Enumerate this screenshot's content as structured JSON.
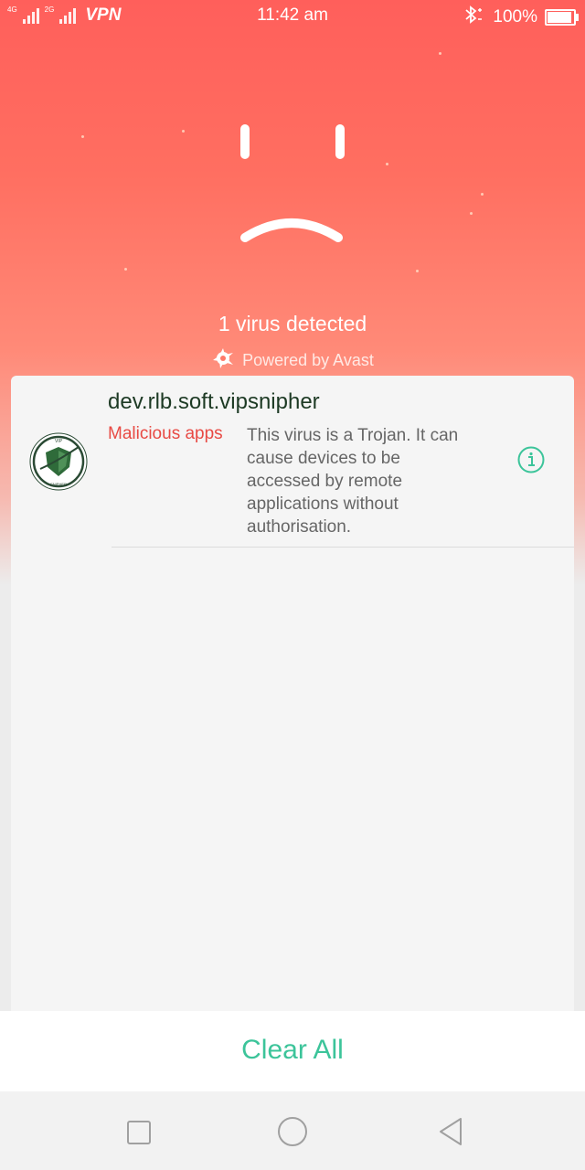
{
  "status_bar": {
    "network_1": "4G",
    "network_2": "2G",
    "vpn": "VPN",
    "time": "11:42 am",
    "battery": "100%",
    "battery_level": 1.0
  },
  "hero": {
    "face_expression": "sad-face-icon",
    "message": "1 virus detected",
    "powered_by": "Powered by Avast"
  },
  "threats": [
    {
      "package": "dev.rlb.soft.vipsnipher",
      "category": "Malicious apps",
      "description": "This virus is a Trojan. It can cause devices to be accessed by remote applications without authorisation.",
      "icon": "vip-snipher-shield-logo",
      "logo_text_top": "VIP",
      "logo_text_bottom": "SNIPHER"
    }
  ],
  "actions": {
    "clear_all": "Clear All"
  },
  "colors": {
    "hero_top": "#ff5f5b",
    "accent_green": "#3cc49a",
    "danger_red": "#e84a44"
  }
}
